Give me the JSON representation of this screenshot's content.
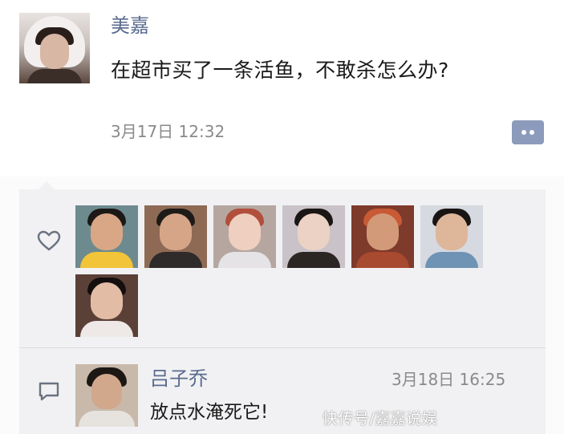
{
  "post": {
    "author": "美嘉",
    "text": "在超市买了一条活鱼，不敢杀怎么办?",
    "time": "3月17日 12:32",
    "comment_toggle_icon": "comment-dots-icon"
  },
  "likes": {
    "icon": "heart-outline-icon",
    "avatars": [
      {
        "name": "liker-avatar-1",
        "colors": {
          "bg": "#6d8a8f",
          "skin": "#d9a785",
          "hair": "#1c1816",
          "body": "#f2c43a"
        }
      },
      {
        "name": "liker-avatar-2",
        "colors": {
          "bg": "#8e6a55",
          "skin": "#d6a588",
          "hair": "#1e1a18",
          "body": "#2f2b2a"
        }
      },
      {
        "name": "liker-avatar-3",
        "colors": {
          "bg": "#b5a7a0",
          "skin": "#efcfbf",
          "hair": "#b14e3c",
          "body": "#e6e3e6"
        }
      },
      {
        "name": "liker-avatar-4",
        "colors": {
          "bg": "#c9c2c8",
          "skin": "#ecd2c4",
          "hair": "#1a1615",
          "body": "#2b2524"
        }
      },
      {
        "name": "liker-avatar-5",
        "colors": {
          "bg": "#7e3a2a",
          "skin": "#d39a79",
          "hair": "#c85a36",
          "body": "#a84a30"
        }
      },
      {
        "name": "liker-avatar-6",
        "colors": {
          "bg": "#d6d9e0",
          "skin": "#deb69a",
          "hair": "#191514",
          "body": "#6f93b4"
        }
      },
      {
        "name": "liker-avatar-7",
        "colors": {
          "bg": "#5b4038",
          "skin": "#e3bca5",
          "hair": "#140f0e",
          "body": "#eee9e6"
        }
      }
    ]
  },
  "comment": {
    "icon": "comment-outline-icon",
    "author": "吕子乔",
    "time": "3月18日 16:25",
    "text": "放点水淹死它!"
  },
  "watermark": {
    "text": "快传号/嘉嘉说娱"
  },
  "colors": {
    "name_link": "#5a6b8e",
    "timestamp": "#8a8a8a",
    "panel_bg": "#f1f1f3",
    "toggle_button": "#8c9bbb"
  }
}
